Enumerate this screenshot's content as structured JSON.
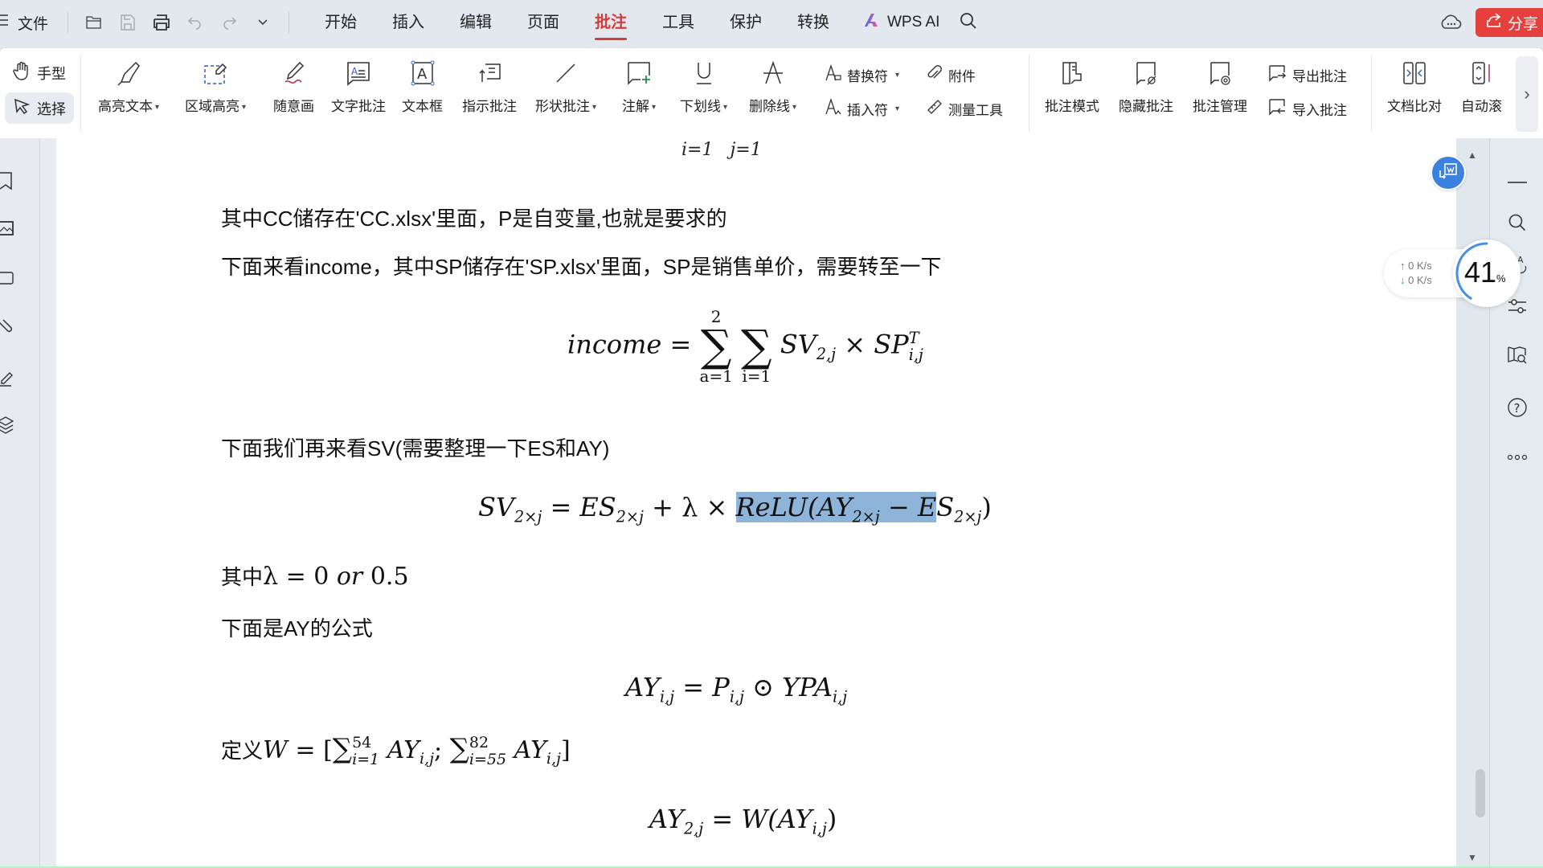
{
  "menubar": {
    "file_label": "文件",
    "tabs": [
      "开始",
      "插入",
      "编辑",
      "页面",
      "批注",
      "工具",
      "保护",
      "转换"
    ],
    "active_tab": "批注",
    "wps_ai_label": "WPS AI",
    "share_label": "分享",
    "icons": [
      "menu-icon",
      "open-folder-icon",
      "save-icon",
      "print-icon",
      "undo-icon",
      "redo-icon",
      "more-chevron-icon",
      "search-icon",
      "cloud-icon",
      "share-icon"
    ]
  },
  "ribbon": {
    "hand_label": "手型",
    "select_label": "选择",
    "items": [
      {
        "label": "高亮文本",
        "dropdown": true
      },
      {
        "label": "区域高亮",
        "dropdown": true
      },
      {
        "label": "随意画",
        "dropdown": false
      },
      {
        "label": "文字批注",
        "dropdown": false
      },
      {
        "label": "文本框",
        "dropdown": false
      },
      {
        "label": "指示批注",
        "dropdown": false
      },
      {
        "label": "形状批注",
        "dropdown": true
      },
      {
        "label": "注解",
        "dropdown": true
      },
      {
        "label": "下划线",
        "dropdown": true
      },
      {
        "label": "删除线",
        "dropdown": true
      }
    ],
    "small_items": {
      "replace": "替换符",
      "insert": "插入符",
      "attachment": "附件",
      "measure": "测量工具",
      "export": "导出批注",
      "import": "导入批注"
    },
    "right_items": [
      {
        "label": "批注模式"
      },
      {
        "label": "隐藏批注"
      },
      {
        "label": "批注管理"
      },
      {
        "label": "文档比对"
      },
      {
        "label": "自动滚"
      }
    ]
  },
  "document": {
    "top_fragment": {
      "i": "i=1",
      "j": "j=1"
    },
    "p1": "其中CC储存在'CC.xlsx'里面，P是自变量,也就是要求的",
    "p2": "下面来看income，其中SP储存在'SP.xlsx'里面，SP是销售单价，需要转至一下",
    "eq_income": {
      "lhs": "income",
      "sum1_top": "2",
      "sum1_bot": "a=1",
      "sum2_bot": "i=1",
      "term1": "SV",
      "term1_sub": "2,j",
      "times": "×",
      "term2": "SP",
      "term2_sub": "i,j",
      "term2_sup": "T"
    },
    "p3": "下面我们再来看SV(需要整理一下ES和AY)",
    "eq_sv": {
      "lhs": "SV",
      "lhs_sub": "2×j",
      "es": "ES",
      "es_sub": "2×j",
      "plus_lambda_times": "+ λ ×",
      "relu_highlighted": "ReLU(AY",
      "ay_sub": "2×j",
      "minus_e": " − E",
      "rest": "S",
      "rest_sub": "2×j",
      "close": ")"
    },
    "p4_text": "其中",
    "p4_math": "λ = 0 ",
    "p4_or": "or",
    "p4_val": " 0.5",
    "p5": "下面是AY的公式",
    "eq_ay": {
      "lhs": "AY",
      "lhs_sub": "i,j",
      "p": "P",
      "p_sub": "i,j",
      "odot": "⊙",
      "ypa": "YPA",
      "ypa_sub": "i,j"
    },
    "p6_text": "定义",
    "p6_math": {
      "w": "W",
      "eq": " = [",
      "s1_top": "54",
      "s1_bot": "i=1",
      "ay1": "AY",
      "ay1_sub": "i,j",
      "semi": ";",
      "s2_top": "82",
      "s2_bot": "i=55",
      "ay2": "AY",
      "ay2_sub": "i,j",
      "close": "]"
    },
    "eq_ay2": {
      "lhs": "AY",
      "lhs_sub": "2,j",
      "rhs": "W(AY",
      "rhs_sub": "i,j",
      "close": ")"
    }
  },
  "widgets": {
    "upload_speed": "0  K/s",
    "download_speed": "0  K/s",
    "progress_percent": 41,
    "progress_label": "41",
    "percent_sign": "%"
  },
  "colors": {
    "accent_red": "#d93a3a",
    "share_red": "#e5403c",
    "highlight_blue": "#8fb4d9",
    "float_blue": "#3b82e0"
  }
}
